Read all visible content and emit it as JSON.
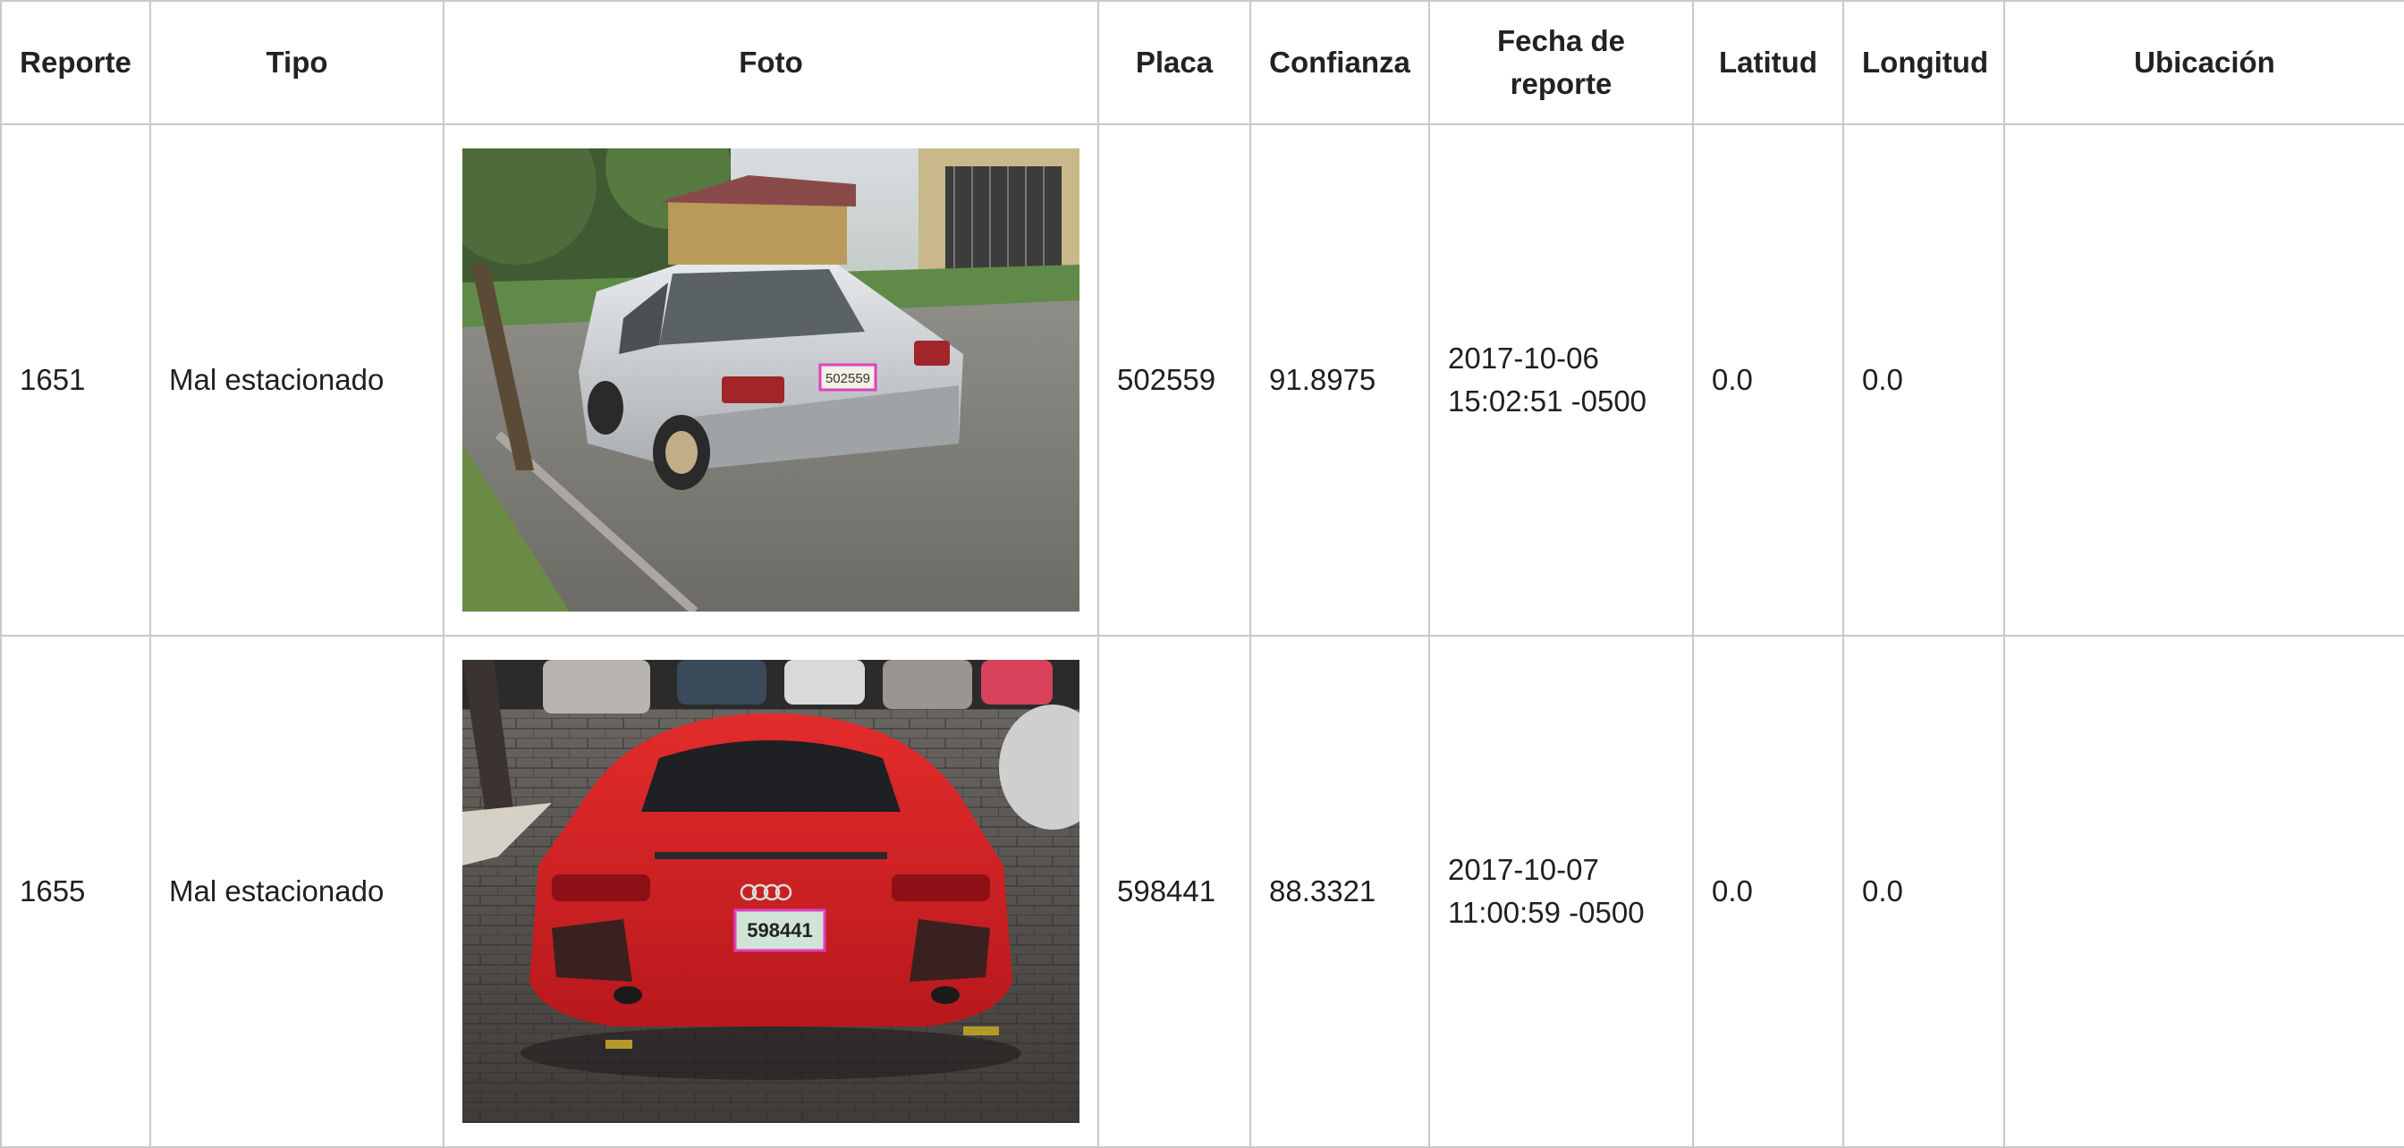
{
  "table": {
    "headers": [
      "Reporte",
      "Tipo",
      "Foto",
      "Placa",
      "Confianza",
      "Fecha de reporte",
      "Latitud",
      "Longitud",
      "Ubicación"
    ],
    "rows": [
      {
        "reporte": "1651",
        "tipo": "Mal estacionado",
        "foto": "silver-sedan-photo",
        "placa_text": "502559",
        "placa": "502559",
        "confianza": "91.8975",
        "fecha_line1": "2017-10-06",
        "fecha_line2": "15:02:51 -0500",
        "latitud": "0.0",
        "longitud": "0.0",
        "ubicacion": ""
      },
      {
        "reporte": "1655",
        "tipo": "Mal estacionado",
        "foto": "red-sports-car-photo",
        "placa_text": "598441",
        "placa": "598441",
        "confianza": "88.3321",
        "fecha_line1": "2017-10-07",
        "fecha_line2": "11:00:59 -0500",
        "latitud": "0.0",
        "longitud": "0.0",
        "ubicacion": ""
      }
    ]
  }
}
